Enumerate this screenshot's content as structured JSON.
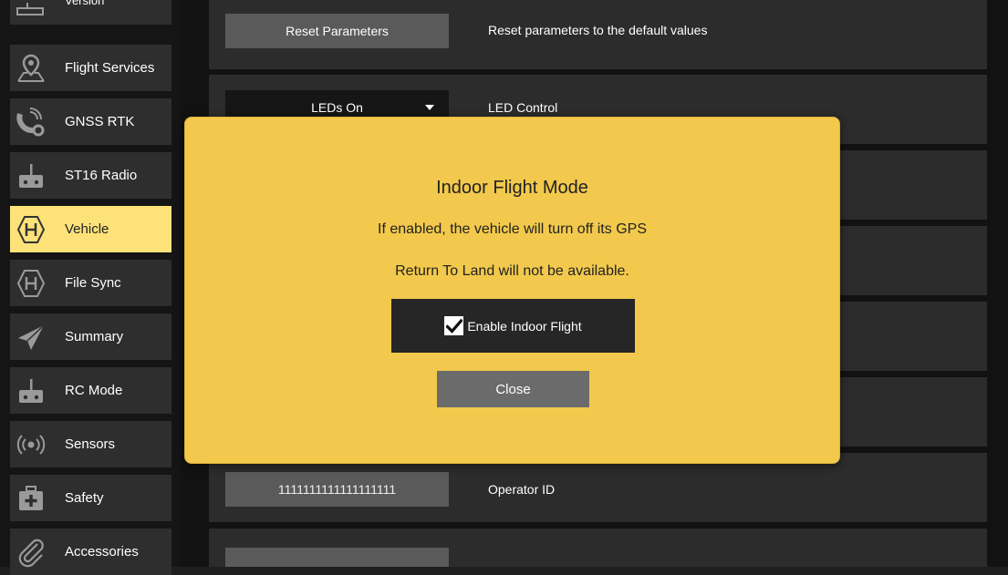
{
  "sidebar": {
    "items": [
      {
        "label": "Version",
        "icon": "version-icon"
      },
      {
        "label": "Flight Services",
        "icon": "map-pin-icon"
      },
      {
        "label": "GNSS RTK",
        "icon": "satellite-gear-icon"
      },
      {
        "label": "ST16 Radio",
        "icon": "radio-icon"
      },
      {
        "label": "Vehicle",
        "icon": "hexagon-h-icon",
        "active": true
      },
      {
        "label": "File Sync",
        "icon": "hexagon-h-icon"
      },
      {
        "label": "Summary",
        "icon": "paper-plane-icon"
      },
      {
        "label": "RC Mode",
        "icon": "radio-icon"
      },
      {
        "label": "Sensors",
        "icon": "broadcast-icon"
      },
      {
        "label": "Safety",
        "icon": "first-aid-icon"
      },
      {
        "label": "Accessories",
        "icon": "paperclip-icon"
      }
    ]
  },
  "main": {
    "rows": [
      {
        "control": "Reset Parameters",
        "description": "Reset parameters to the default values"
      },
      {
        "control": "LEDs On",
        "description": "LED Control"
      },
      {
        "control": "1111111111111111111",
        "description": "Operator ID"
      }
    ]
  },
  "modal": {
    "title": "Indoor Flight Mode",
    "line1": "If enabled, the vehicle will turn off its GPS",
    "line2": "Return To Land will not be available.",
    "toggle_label": "Enable Indoor Flight",
    "toggle_checked": true,
    "close_label": "Close"
  },
  "colors": {
    "accent_yellow": "#f2c94c",
    "active_sidebar": "#fde27a",
    "panel": "#2c2c2c"
  }
}
